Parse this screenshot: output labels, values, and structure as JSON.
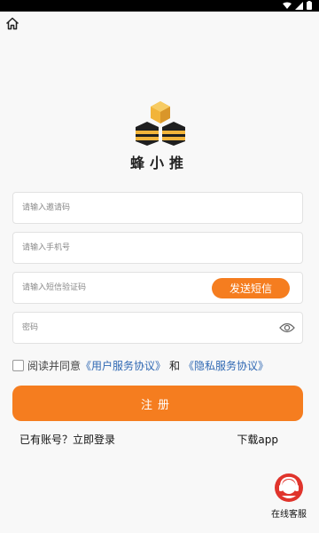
{
  "app": {
    "name": "蜂小推"
  },
  "form": {
    "invite_placeholder": "请输入邀请码",
    "phone_placeholder": "请输入手机号",
    "sms_placeholder": "请输入短信验证码",
    "send_sms_label": "发送短信",
    "password_placeholder": "密码"
  },
  "agreement": {
    "read_agree": "阅读并同意",
    "user_agreement": "《用户服务协议》",
    "and": "和",
    "privacy_agreement": "《隐私服务协议》"
  },
  "actions": {
    "register_label": "注册",
    "login_prompt": "已有账号？立即登录",
    "download_label": "下载app"
  },
  "support": {
    "label": "在线客服"
  },
  "colors": {
    "accent": "#f57d1f",
    "link": "#2f68b3",
    "logo_dark": "#1f1f1f",
    "logo_gold": "#f2b43a"
  },
  "icons": [
    "home-icon",
    "eye-icon",
    "customer-service-icon",
    "wifi-icon",
    "signal-icon",
    "battery-icon"
  ]
}
